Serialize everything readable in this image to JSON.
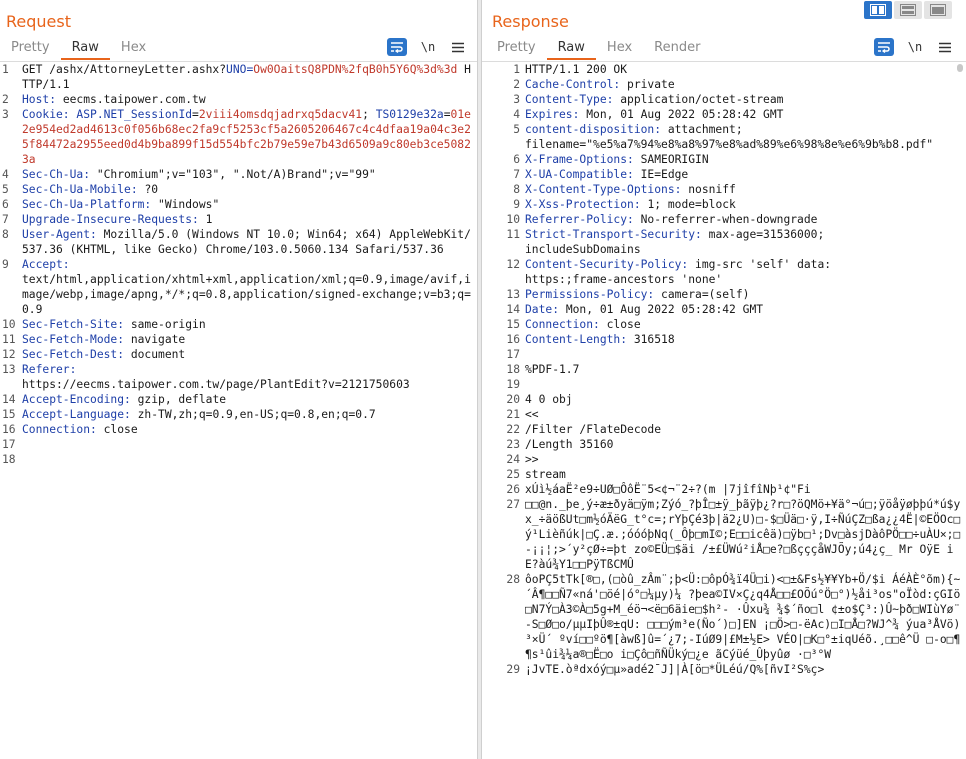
{
  "request": {
    "title": "Request",
    "tabs": [
      "Pretty",
      "Raw",
      "Hex"
    ],
    "active_tab": "Raw",
    "newline_label": "\\n",
    "lines": [
      {
        "n": "1",
        "parts": [
          {
            "t": "GET /ashx/AttorneyLetter.ashx?",
            "c": "plain"
          },
          {
            "t": "UNO=",
            "c": "ins"
          },
          {
            "t": "Ow0OaitsQ8PDN%2fqB0h5Y6Q%3d%3d",
            "c": "red"
          },
          {
            "t": " HTTP/1.1",
            "c": "plain"
          }
        ]
      },
      {
        "n": "2",
        "parts": [
          {
            "t": "Host: ",
            "c": "hname"
          },
          {
            "t": "eecms.taipower.com.tw",
            "c": "plain"
          }
        ]
      },
      {
        "n": "3",
        "parts": [
          {
            "t": "Cookie: ",
            "c": "hname"
          },
          {
            "t": "ASP.NET_SessionId",
            "c": "ins"
          },
          {
            "t": "=",
            "c": "plain"
          },
          {
            "t": "2viii4omsdqjadrxq5dacv41",
            "c": "red"
          },
          {
            "t": "; ",
            "c": "plain"
          },
          {
            "t": "TS0129e32a",
            "c": "ins"
          },
          {
            "t": "=",
            "c": "plain"
          },
          {
            "t": "01e2e954ed2ad4613c0f056b68ec2fa9cf5253cf5a2605206467c4c4dfaa19a04c3e25f84472a2955eed0d4b9ba899f15d554bfc2b79e59e7b43d6509a9c80eb3ce50823a",
            "c": "red"
          }
        ]
      },
      {
        "n": "4",
        "parts": [
          {
            "t": "Sec-Ch-Ua: ",
            "c": "hname"
          },
          {
            "t": "\"Chromium\";v=\"103\", \".Not/A)Brand\";v=\"99\"",
            "c": "plain"
          }
        ]
      },
      {
        "n": "5",
        "parts": [
          {
            "t": "Sec-Ch-Ua-Mobile: ",
            "c": "hname"
          },
          {
            "t": "?0",
            "c": "plain"
          }
        ]
      },
      {
        "n": "6",
        "parts": [
          {
            "t": "Sec-Ch-Ua-Platform: ",
            "c": "hname"
          },
          {
            "t": "\"Windows\"",
            "c": "plain"
          }
        ]
      },
      {
        "n": "7",
        "parts": [
          {
            "t": "Upgrade-Insecure-Requests: ",
            "c": "hname"
          },
          {
            "t": "1",
            "c": "plain"
          }
        ]
      },
      {
        "n": "8",
        "parts": [
          {
            "t": "User-Agent: ",
            "c": "hname"
          },
          {
            "t": "Mozilla/5.0 (Windows NT 10.0; Win64; x64) AppleWebKit/537.36 (KHTML, like Gecko) Chrome/103.0.5060.134 Safari/537.36",
            "c": "plain"
          }
        ]
      },
      {
        "n": "9",
        "parts": [
          {
            "t": "Accept:",
            "c": "hname"
          },
          {
            "t": "\ntext/html,application/xhtml+xml,application/xml;q=0.9,image/avif,image/webp,image/apng,*/*;q=0.8,application/signed-exchange;v=b3;q=0.9",
            "c": "plain"
          }
        ]
      },
      {
        "n": "10",
        "parts": [
          {
            "t": "Sec-Fetch-Site: ",
            "c": "hname"
          },
          {
            "t": "same-origin",
            "c": "plain"
          }
        ]
      },
      {
        "n": "11",
        "parts": [
          {
            "t": "Sec-Fetch-Mode: ",
            "c": "hname"
          },
          {
            "t": "navigate",
            "c": "plain"
          }
        ]
      },
      {
        "n": "12",
        "parts": [
          {
            "t": "Sec-Fetch-Dest: ",
            "c": "hname"
          },
          {
            "t": "document",
            "c": "plain"
          }
        ]
      },
      {
        "n": "13",
        "parts": [
          {
            "t": "Referer:",
            "c": "hname"
          },
          {
            "t": "\nhttps://eecms.taipower.com.tw/page/PlantEdit?v=2121750603",
            "c": "plain"
          }
        ]
      },
      {
        "n": "14",
        "parts": [
          {
            "t": "Accept-Encoding: ",
            "c": "hname"
          },
          {
            "t": "gzip, deflate",
            "c": "plain"
          }
        ]
      },
      {
        "n": "15",
        "parts": [
          {
            "t": "Accept-Language: ",
            "c": "hname"
          },
          {
            "t": "zh-TW,zh;q=0.9,en-US;q=0.8,en;q=0.7",
            "c": "plain"
          }
        ]
      },
      {
        "n": "16",
        "parts": [
          {
            "t": "Connection: ",
            "c": "hname"
          },
          {
            "t": "close",
            "c": "plain"
          }
        ]
      },
      {
        "n": "17",
        "parts": [
          {
            "t": "",
            "c": "plain"
          }
        ]
      },
      {
        "n": "18",
        "parts": [
          {
            "t": "",
            "c": "plain"
          }
        ]
      }
    ]
  },
  "response": {
    "title": "Response",
    "tabs": [
      "Pretty",
      "Raw",
      "Hex",
      "Render"
    ],
    "active_tab": "Raw",
    "newline_label": "\\n",
    "lines": [
      {
        "n": "1",
        "parts": [
          {
            "t": "HTTP/1.1 200 OK",
            "c": "plain"
          }
        ]
      },
      {
        "n": "2",
        "parts": [
          {
            "t": "Cache-Control: ",
            "c": "hname"
          },
          {
            "t": "private",
            "c": "plain"
          }
        ]
      },
      {
        "n": "3",
        "parts": [
          {
            "t": "Content-Type: ",
            "c": "hname"
          },
          {
            "t": "application/octet-stream",
            "c": "plain"
          }
        ]
      },
      {
        "n": "4",
        "parts": [
          {
            "t": "Expires: ",
            "c": "hname"
          },
          {
            "t": "Mon, 01 Aug 2022 05:28:42 GMT",
            "c": "plain"
          }
        ]
      },
      {
        "n": "5",
        "parts": [
          {
            "t": "content-disposition: ",
            "c": "hname"
          },
          {
            "t": "attachment;\nfilename=\"%e5%a7%94%e8%a8%97%e8%ad%89%e6%98%8e%e6%9b%b8.pdf\"",
            "c": "plain"
          }
        ]
      },
      {
        "n": "6",
        "parts": [
          {
            "t": "X-Frame-Options: ",
            "c": "hname"
          },
          {
            "t": "SAMEORIGIN",
            "c": "plain"
          }
        ]
      },
      {
        "n": "7",
        "parts": [
          {
            "t": "X-UA-Compatible: ",
            "c": "hname"
          },
          {
            "t": "IE=Edge",
            "c": "plain"
          }
        ]
      },
      {
        "n": "8",
        "parts": [
          {
            "t": "X-Content-Type-Options: ",
            "c": "hname"
          },
          {
            "t": "nosniff",
            "c": "plain"
          }
        ]
      },
      {
        "n": "9",
        "parts": [
          {
            "t": "X-Xss-Protection: ",
            "c": "hname"
          },
          {
            "t": "1; mode=block",
            "c": "plain"
          }
        ]
      },
      {
        "n": "10",
        "parts": [
          {
            "t": "Referrer-Policy: ",
            "c": "hname"
          },
          {
            "t": "No-referrer-when-downgrade",
            "c": "plain"
          }
        ]
      },
      {
        "n": "11",
        "parts": [
          {
            "t": "Strict-Transport-Security: ",
            "c": "hname"
          },
          {
            "t": "max-age=31536000;\nincludeSubDomains",
            "c": "plain"
          }
        ]
      },
      {
        "n": "12",
        "parts": [
          {
            "t": "Content-Security-Policy: ",
            "c": "hname"
          },
          {
            "t": "img-src 'self' data:\nhttps:;frame-ancestors 'none'",
            "c": "plain"
          }
        ]
      },
      {
        "n": "13",
        "parts": [
          {
            "t": "Permissions-Policy: ",
            "c": "hname"
          },
          {
            "t": "camera=(self)",
            "c": "plain"
          }
        ]
      },
      {
        "n": "14",
        "parts": [
          {
            "t": "Date: ",
            "c": "hname"
          },
          {
            "t": "Mon, 01 Aug 2022 05:28:42 GMT",
            "c": "plain"
          }
        ]
      },
      {
        "n": "15",
        "parts": [
          {
            "t": "Connection: ",
            "c": "hname"
          },
          {
            "t": "close",
            "c": "plain"
          }
        ]
      },
      {
        "n": "16",
        "parts": [
          {
            "t": "Content-Length: ",
            "c": "hname"
          },
          {
            "t": "316518",
            "c": "plain"
          }
        ]
      },
      {
        "n": "17",
        "parts": [
          {
            "t": "",
            "c": "plain"
          }
        ]
      },
      {
        "n": "18",
        "parts": [
          {
            "t": "%PDF-1.7",
            "c": "plain"
          }
        ]
      },
      {
        "n": "19",
        "parts": [
          {
            "t": "",
            "c": "plain"
          }
        ]
      },
      {
        "n": "20",
        "parts": [
          {
            "t": "4 0 obj",
            "c": "plain"
          }
        ]
      },
      {
        "n": "21",
        "parts": [
          {
            "t": "<<",
            "c": "plain"
          }
        ]
      },
      {
        "n": "22",
        "parts": [
          {
            "t": "/Filter /FlateDecode",
            "c": "plain"
          }
        ]
      },
      {
        "n": "23",
        "parts": [
          {
            "t": "/Length 35160",
            "c": "plain"
          }
        ]
      },
      {
        "n": "24",
        "parts": [
          {
            "t": ">>",
            "c": "plain"
          }
        ]
      },
      {
        "n": "25",
        "parts": [
          {
            "t": "stream",
            "c": "plain"
          }
        ]
      },
      {
        "n": "26",
        "parts": [
          {
            "t": "xÚì½áaË²e9÷UØ□ÔôË¨5<¢¬¨2÷?(m |7jîfîNþ¹¢\"Fi",
            "c": "plain"
          }
        ]
      },
      {
        "n": "27",
        "parts": [
          {
            "t": "□□@n._þe¸ý÷æ±ðyä□ÿm;Zýó_?þÎ□±ÿ_þãÿþ¿?r□?öQMö+¥ä°¬ú□;ÿöåÿøþþú*ú$yx_÷äößUt□m½óÄëG_t°c=;rYþÇé3þ|ä2¿U)□-$□Üä□·ÿ,I÷ÑúÇZ□ßa¿¿4Ë|©EÖOc□ý¹Lièñúk|□Ç.æ.;óóóþNq(_Ôþ□mI©;E□□icêä)□ÿb□¹;Dv□àsjDàôPÖ□□÷uÀU×;□-¡¡¦;>´y²çØ÷=þt zo©EÜ□$äi /±£ÜWú²iÅ□e?□ßçççåWJÕy;ú4¿ç_ Mr OÿE iE?àú¾Y1□□PÿTßCMÛ",
            "c": "plain"
          }
        ]
      },
      {
        "n": "28",
        "parts": [
          {
            "t": "ôoPÇ5tTk[®□,(□òû_zÂm¨;þ<Ü:□ôpÓ¾ï4Ü□i)<□±&Fs½¥¥Yb+Ö/$i ÁéÀÈ°õm){~´Â¶□□Ñ7«ná'□öé|ó°□¼µy)¼ ?þea©IV×Ç¿q4Å□□£OÕú°Ö□°)½åi³os\"oÏòd:çGIö□N7Ý□À3©À□5g+M_éö¬<ë□6äie□$h²- ·Ûxu¾ ¾$´ño□l ¢±o$Ç³:)Û~þð□WIùYø¨-S□Ø□o/µµIþÛ®±qU: □□□ým³e(Ño´)□]EN ¡□Ö>□-ëAc)□I□Å□?WJ^¾ ýua³ÅVö)³×Ü´ ºví□□ºö¶[àwß]û=´¿7;-IúØ9|£M±½E> VÉO|□K□°±iqUéõ.¸□□ê^Ü □-o□¶¶s¹ûi¾¼a®□Ë□o i□Çô□ñÑÜký□¿e ãCýüé_Ûþyûø ·□³°W",
            "c": "plain"
          }
        ]
      },
      {
        "n": "29",
        "parts": [
          {
            "t": "¡JvTE.òªdxóý□µ»adé2¯J]|À[ö□*ÜLéú/Q%[ñvI²S%ç>",
            "c": "plain"
          }
        ]
      }
    ]
  },
  "view_toggle": [
    "split-horizontal",
    "split-vertical",
    "tabs"
  ],
  "colors": {
    "accent": "#e8641b",
    "header_name": "#1e3fa8",
    "param_value": "#c0392b",
    "button_blue": "#2b74c9"
  }
}
